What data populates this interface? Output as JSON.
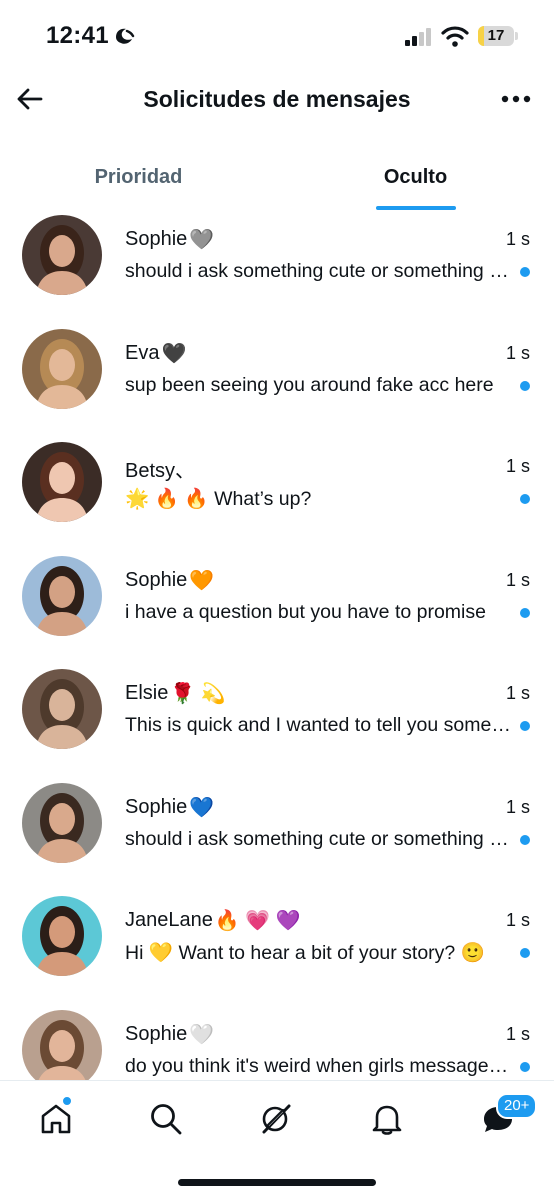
{
  "status_bar": {
    "time": "12:41",
    "battery": "17",
    "battery_level": 0.17
  },
  "header": {
    "title": "Solicitudes de mensajes"
  },
  "tabs": [
    {
      "label": "Prioridad",
      "active": false
    },
    {
      "label": "Oculto",
      "active": true
    }
  ],
  "messages": [
    {
      "name": "Sophie",
      "emoji": "🩶",
      "time": "1 s",
      "preview": "should i ask something cute or something spicy?",
      "unread": true,
      "avatar": {
        "bg": "#4a3a35",
        "skin": "#d9a88c",
        "hair": "#3a241a"
      }
    },
    {
      "name": "Eva",
      "emoji": "🖤",
      "time": "1 s",
      "preview": "sup been seeing you around fake acc here",
      "unread": true,
      "avatar": {
        "bg": "#8a6a4a",
        "skin": "#e3b898",
        "hair": "#b68a55"
      }
    },
    {
      "name": "Betsy、",
      "emoji": "",
      "time": "1 s",
      "preview": "🌟 🔥 🔥 What’s up?",
      "unread": true,
      "avatar": {
        "bg": "#3b2c26",
        "skin": "#efc7b1",
        "hair": "#5a2f20"
      }
    },
    {
      "name": "Sophie",
      "emoji": "🧡",
      "time": "1 s",
      "preview": "i have a question but you have to promise",
      "unread": true,
      "avatar": {
        "bg": "#9dbbd9",
        "skin": "#d3a184",
        "hair": "#2e1f18"
      }
    },
    {
      "name": "Elsie",
      "emoji": "🌹 💫",
      "time": "1 s",
      "preview": "This is quick and I wanted to tell you something",
      "unread": true,
      "avatar": {
        "bg": "#6d5648",
        "skin": "#d9b49a",
        "hair": "#4e3a2c"
      }
    },
    {
      "name": "Sophie",
      "emoji": "💙",
      "time": "1 s",
      "preview": "should i ask something cute or something spicy?",
      "unread": true,
      "avatar": {
        "bg": "#8c8a86",
        "skin": "#d9a98c",
        "hair": "#3a2920"
      }
    },
    {
      "name": "JaneLane",
      "emoji": "    🔥 💗 💜",
      "time": "1 s",
      "preview": "Hi 💛 Want to hear a bit of your story? 🙂",
      "unread": true,
      "avatar": {
        "bg": "#5cc8d6",
        "skin": "#d49a7a",
        "hair": "#2b1e18"
      }
    },
    {
      "name": "Sophie",
      "emoji": "🤍",
      "time": "1 s",
      "preview": "do you think it's weird when girls message first?",
      "unread": true,
      "avatar": {
        "bg": "#b9a08f",
        "skin": "#e2b59a",
        "hair": "#6b4a34"
      }
    }
  ],
  "bottom_nav": {
    "items": [
      {
        "icon": "home-icon"
      },
      {
        "icon": "search-icon"
      },
      {
        "icon": "grok-icon"
      },
      {
        "icon": "bell-icon"
      },
      {
        "icon": "messages-icon"
      }
    ],
    "messages_badge": "20+"
  },
  "colors": {
    "accent": "#1d9bf0",
    "text": "#0f1419",
    "muted": "#536471"
  }
}
